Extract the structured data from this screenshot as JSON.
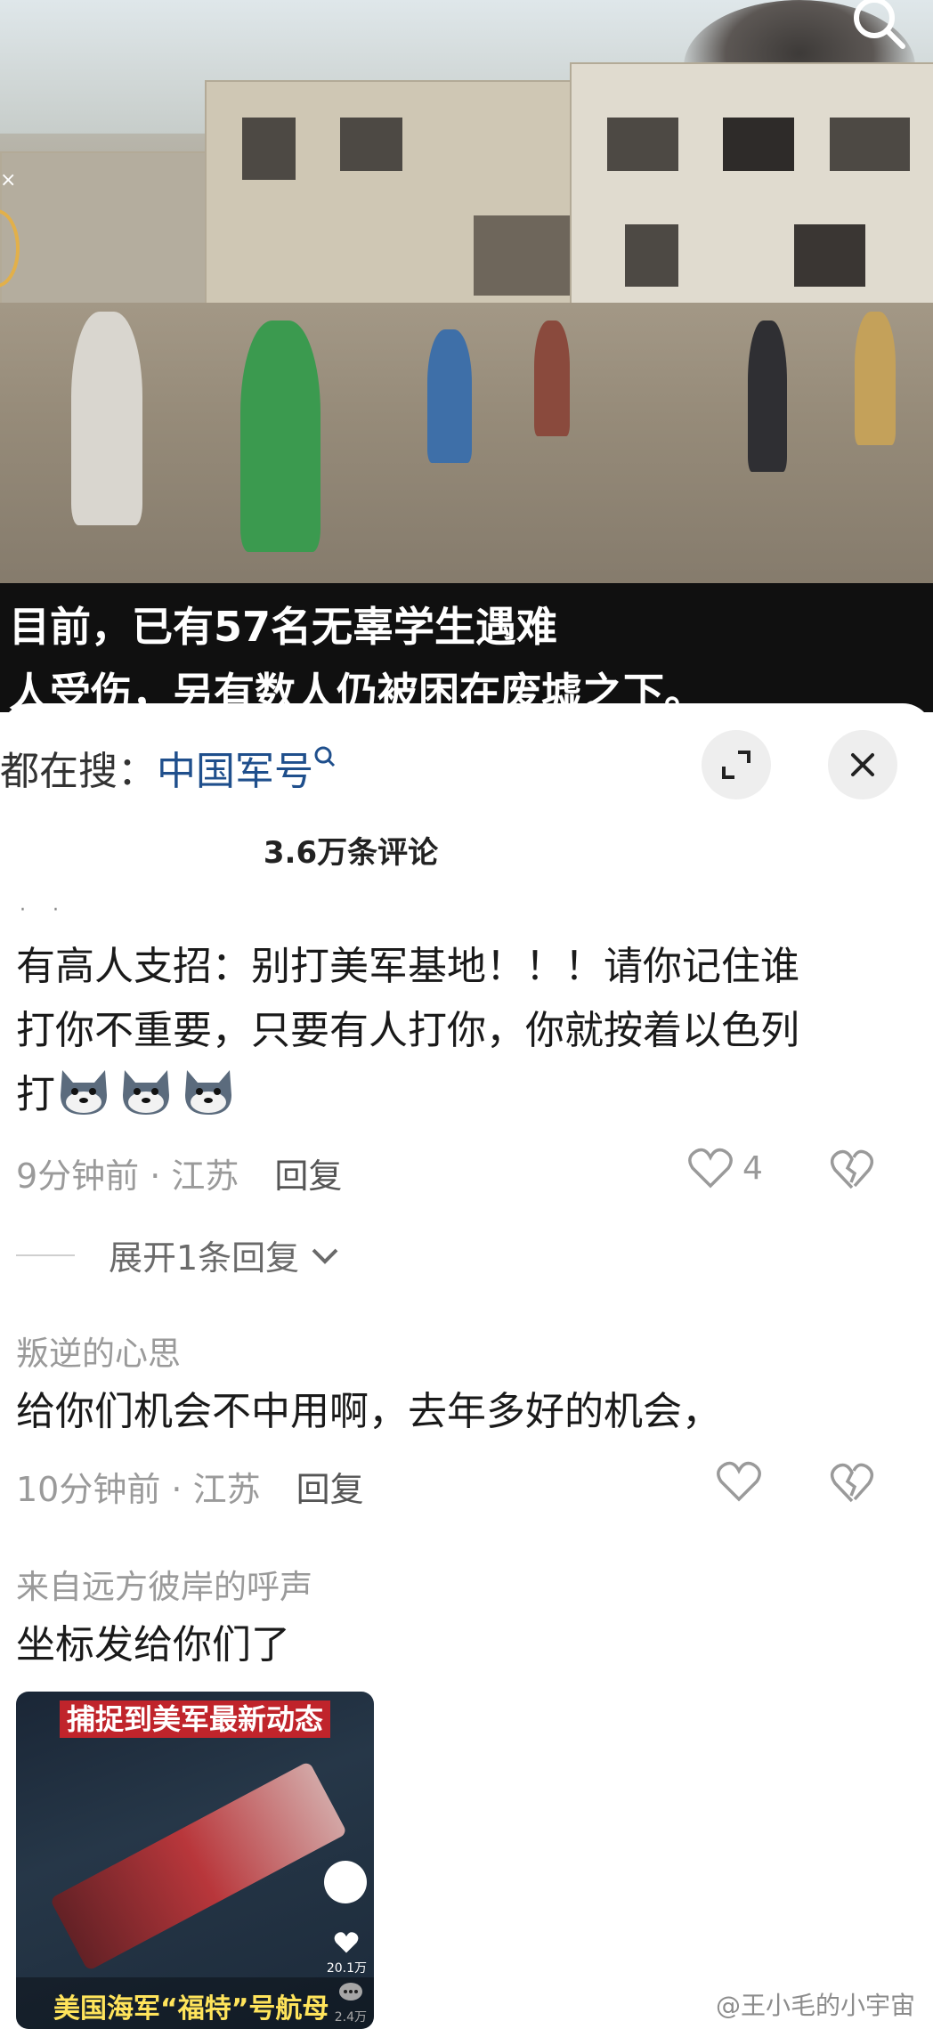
{
  "video": {
    "caption_line1": "目前，已有57名无辜学生遇难",
    "caption_line2": "人受伤，另有数人仍被困在废墟之下。"
  },
  "sheet": {
    "hot_search_prefix": "都在搜：",
    "hot_search_keyword": "中国军号",
    "comment_count": "3.6万条评论"
  },
  "comments": [
    {
      "text_line1": "有高人支招：别打美军基地！！！请你记住谁",
      "text_line2": "打你不重要，只要有人打你，你就按着以色列",
      "text_line3": "打",
      "time_location": "9分钟前 · 江苏",
      "reply_label": "回复",
      "likes": "4",
      "expand_label": "展开1条回复"
    },
    {
      "username": "叛逆的心思",
      "text": "给你们机会不中用啊，去年多好的机会，",
      "time_location": "10分钟前 · 江苏",
      "reply_label": "回复"
    },
    {
      "username": "来自远方彼岸的呼声",
      "text": "坐标发给你们了",
      "image_title": "捕捉到美军最新动态",
      "image_caption": "美国海军“福特”号航母",
      "image_likes": "20.1万",
      "image_comments": "2.4万"
    }
  ],
  "watermark": "@王小毛的小宇宙"
}
